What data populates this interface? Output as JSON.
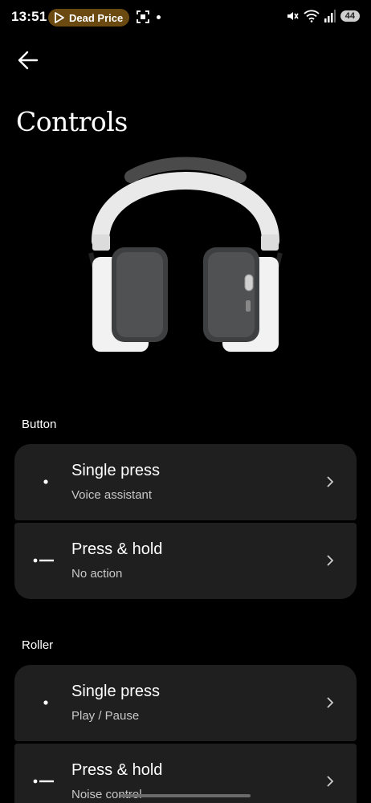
{
  "status_bar": {
    "time": "13:51",
    "pill_label": "Dead Price",
    "battery": "44"
  },
  "page": {
    "title": "Controls"
  },
  "sections": [
    {
      "label": "Button",
      "items": [
        {
          "title": "Single press",
          "value": "Voice assistant",
          "gesture_icon": "single-dot"
        },
        {
          "title": "Press & hold",
          "value": "No action",
          "gesture_icon": "dot-dash"
        }
      ]
    },
    {
      "label": "Roller",
      "items": [
        {
          "title": "Single press",
          "value": "Play / Pause",
          "gesture_icon": "single-dot"
        },
        {
          "title": "Press & hold",
          "value": "Noise control",
          "gesture_icon": "dot-dash"
        }
      ]
    }
  ],
  "colors": {
    "background": "#000000",
    "card": "#1f1f1f",
    "pill": "#6b4a12"
  }
}
